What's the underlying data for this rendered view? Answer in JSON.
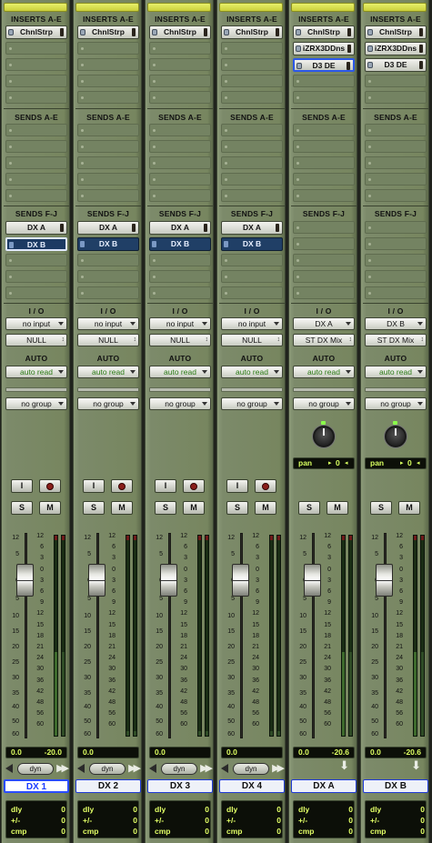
{
  "labels": {
    "inserts": "INSERTS A-E",
    "sends_ae": "SENDS A-E",
    "sends_fj": "SENDS F-J",
    "io": "I / O",
    "auto": "AUTO",
    "input_button": "I",
    "solo": "S",
    "mute": "M",
    "dyn": "dyn",
    "pan": "pan",
    "dly": "dly",
    "plusminus": "+/-",
    "cmp": "cmp"
  },
  "scale_marks": [
    "12",
    "5",
    "0",
    "5",
    "10",
    "15",
    "20",
    "25",
    "30",
    "35",
    "40",
    "50",
    "60",
    "∞"
  ],
  "meter_marks": [
    "12",
    "6",
    "3",
    "0",
    "3",
    "6",
    "9",
    "12",
    "15",
    "18",
    "21",
    "24",
    "30",
    "36",
    "42",
    "48",
    "56",
    "60"
  ],
  "channels": [
    {
      "name": "DX 1",
      "active": true,
      "inserts": [
        "ChnlStrp",
        "",
        "",
        "",
        ""
      ],
      "sends_fj": [
        "DX A",
        "DX B",
        "",
        "",
        ""
      ],
      "send_highlight": 1,
      "input": "no input",
      "output": "NULL",
      "auto": "auto read",
      "group": "no group",
      "has_pan": false,
      "pan_value": "",
      "fader_position": 0.23,
      "volume": "0.0",
      "peak": "-20.0",
      "dly": "0",
      "plusminus": "0",
      "cmp": "0",
      "has_input_button": true,
      "has_dyn": true
    },
    {
      "name": "DX 2",
      "active": false,
      "inserts": [
        "ChnlStrp",
        "",
        "",
        "",
        ""
      ],
      "sends_fj": [
        "DX A",
        "DX B",
        "",
        "",
        ""
      ],
      "send_highlight": -1,
      "input": "no input",
      "output": "NULL",
      "auto": "auto read",
      "group": "no group",
      "has_pan": false,
      "pan_value": "",
      "fader_position": 0.23,
      "volume": "0.0",
      "peak": "",
      "dly": "0",
      "plusminus": "0",
      "cmp": "0",
      "has_input_button": true,
      "has_dyn": true
    },
    {
      "name": "DX 3",
      "active": false,
      "inserts": [
        "ChnlStrp",
        "",
        "",
        "",
        ""
      ],
      "sends_fj": [
        "DX A",
        "DX B",
        "",
        "",
        ""
      ],
      "send_highlight": -1,
      "input": "no input",
      "output": "NULL",
      "auto": "auto read",
      "group": "no group",
      "has_pan": false,
      "pan_value": "",
      "fader_position": 0.23,
      "volume": "0.0",
      "peak": "",
      "dly": "0",
      "plusminus": "0",
      "cmp": "0",
      "has_input_button": true,
      "has_dyn": true
    },
    {
      "name": "DX 4",
      "active": false,
      "inserts": [
        "ChnlStrp",
        "",
        "",
        "",
        ""
      ],
      "sends_fj": [
        "DX A",
        "DX B",
        "",
        "",
        ""
      ],
      "send_highlight": -1,
      "input": "no input",
      "output": "NULL",
      "auto": "auto read",
      "group": "no group",
      "has_pan": false,
      "pan_value": "",
      "fader_position": 0.23,
      "volume": "0.0",
      "peak": "",
      "dly": "0",
      "plusminus": "0",
      "cmp": "0",
      "has_input_button": true,
      "has_dyn": true
    },
    {
      "name": "DX A",
      "active": false,
      "inserts": [
        "ChnlStrp",
        "iZRX3DDns",
        "D3 DE",
        "",
        ""
      ],
      "selected_insert": 2,
      "sends_fj": [
        "",
        "",
        "",
        "",
        ""
      ],
      "send_highlight": -1,
      "input": "DX A",
      "output": "ST DX Mix",
      "auto": "auto read",
      "group": "no group",
      "has_pan": true,
      "pan_value": "0",
      "fader_position": 0.23,
      "volume": "0.0",
      "peak": "-20.6",
      "dly": "0",
      "plusminus": "0",
      "cmp": "0",
      "has_input_button": false,
      "has_dyn": false
    },
    {
      "name": "DX B",
      "active": false,
      "inserts": [
        "ChnlStrp",
        "iZRX3DDns",
        "D3 DE",
        "",
        ""
      ],
      "selected_insert": -1,
      "sends_fj": [
        "",
        "",
        "",
        "",
        ""
      ],
      "send_highlight": -1,
      "input": "DX B",
      "output": "ST DX Mix",
      "auto": "auto read",
      "group": "no group",
      "has_pan": true,
      "pan_value": "0",
      "fader_position": 0.23,
      "volume": "0.0",
      "peak": "-20.6",
      "dly": "0",
      "plusminus": "0",
      "cmp": "0",
      "has_input_button": false,
      "has_dyn": false
    }
  ]
}
